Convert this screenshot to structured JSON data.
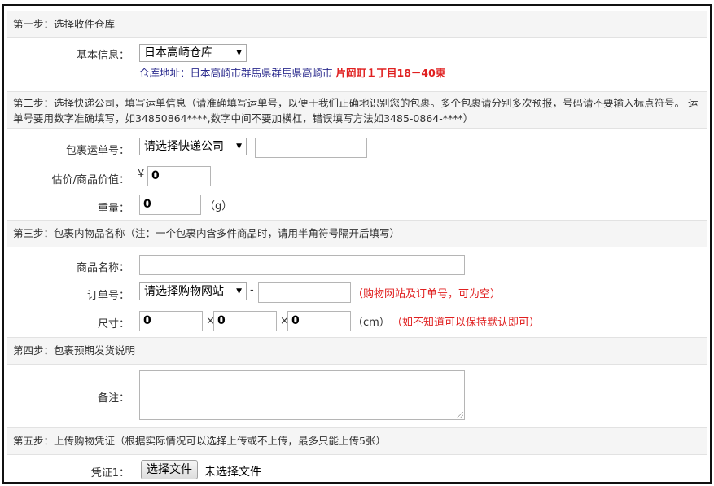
{
  "steps": {
    "step1": "第一步：选择收件仓库",
    "step2": "第二步：选择快递公司，填写运单信息（请准确填写运单号，以便于我们正确地识别您的包裹。多个包裹请分别多次预报，号码请不要输入标点符号。 运单号要用数字准确填写，如34850864****,数字中间不要加横杠，错误填写方法如3485-0864-****）",
    "step3": "第三步：包裹内物品名称（注：一个包裹内含多件商品时，请用半角符号隔开后填写）",
    "step4": "第四步：包裹预期发货说明",
    "step5": "第五步：上传购物凭证（根据实际情况可以选择上传或不上传，最多只能上传5张）"
  },
  "warehouse": {
    "label": "基本信息：",
    "selected": "日本高崎仓库",
    "address_prefix": "仓库地址：日本高崎市群馬県群馬県高崎市",
    "address_highlight": "片岡町１丁目18－40東"
  },
  "tracking": {
    "label": "包裹运单号：",
    "courier_selected": "请选择快递公司",
    "number_value": ""
  },
  "value": {
    "label": "估价/商品价值：",
    "currency": "¥",
    "amount": "0"
  },
  "weight": {
    "label": "重量：",
    "amount": "0",
    "unit": "（g）"
  },
  "item": {
    "name_label": "商品名称：",
    "name_value": "",
    "order_label": "订单号：",
    "shop_selected": "请选择购物网站",
    "dash": "-",
    "order_value": "",
    "order_hint": "（购物网站及订单号，可为空）"
  },
  "size": {
    "label": "尺寸：",
    "length": "0",
    "width": "0",
    "height": "0",
    "times": "×",
    "unit": "（cm）",
    "hint": "（如不知道可以保持默认即可）"
  },
  "note": {
    "label": "备注：",
    "value": ""
  },
  "voucher": {
    "label": "凭证1：",
    "button": "选择文件",
    "status": "未选择文件"
  },
  "icons": {
    "dropdown_arrow": "▼"
  },
  "colors": {
    "highlight_red": "#e02020",
    "address_blue": "#2c2c8e",
    "step_bg": "#f5f5f5"
  }
}
